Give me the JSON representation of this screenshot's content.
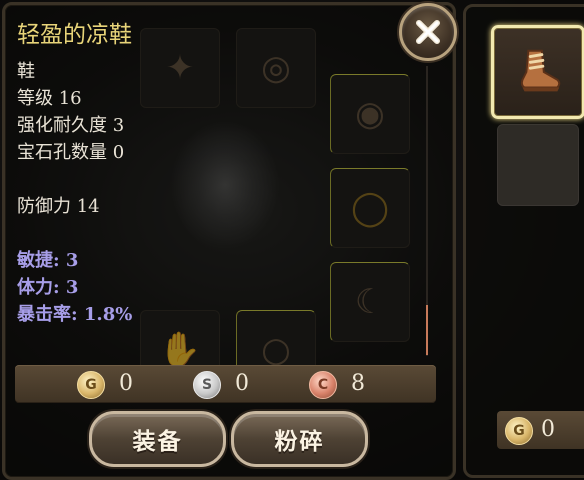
{
  "item": {
    "name": "轻盈的凉鞋",
    "type": "鞋",
    "level": "等级 16",
    "durability": "强化耐久度 3",
    "gem_slots": "宝石孔数量 0",
    "defense": "防御力 14",
    "bonuses": [
      "敏捷: 3",
      "体力: 3",
      "暴击率: 1.8%"
    ]
  },
  "currency": {
    "gold": {
      "symbol": "G",
      "value": "0"
    },
    "silver": {
      "symbol": "S",
      "value": "0"
    },
    "copper": {
      "symbol": "C",
      "value": "8"
    }
  },
  "buttons": {
    "equip": "装备",
    "smash": "粉碎"
  },
  "side_panel": {
    "gold": {
      "symbol": "G",
      "value": "0"
    }
  },
  "icons": {
    "close": "close-x-icon",
    "selected_item": "boot-icon"
  },
  "colors": {
    "title": "#e8d479",
    "stat": "#a79ee8",
    "text": "#e9e3d6"
  }
}
